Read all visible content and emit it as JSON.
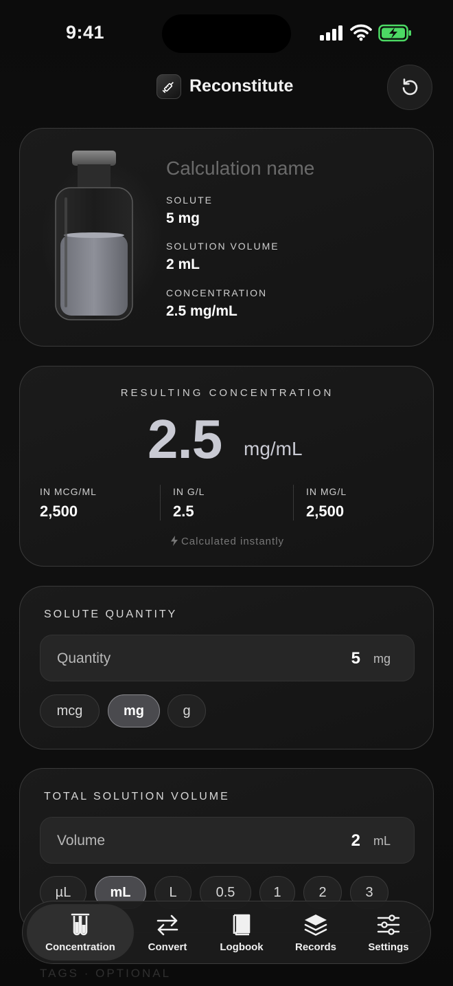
{
  "status": {
    "time": "9:41"
  },
  "header": {
    "title": "Reconstitute"
  },
  "summary": {
    "calc_name_placeholder": "Calculation name",
    "solute_label": "SOLUTE",
    "solute_value": "5 mg",
    "volume_label": "SOLUTION VOLUME",
    "volume_value": "2 mL",
    "concentration_label": "CONCENTRATION",
    "concentration_value": "2.5 mg/mL"
  },
  "result": {
    "label": "RESULTING CONCENTRATION",
    "value": "2.5",
    "unit": "mg/mL",
    "stats": [
      {
        "label": "IN MCG/ML",
        "value": "2,500"
      },
      {
        "label": "IN G/L",
        "value": "2.5"
      },
      {
        "label": "IN MG/L",
        "value": "2,500"
      }
    ],
    "instant": "Calculated instantly"
  },
  "solute": {
    "title": "SOLUTE QUANTITY",
    "field_label": "Quantity",
    "field_value": "5",
    "field_unit": "mg",
    "units": [
      "mcg",
      "mg",
      "g"
    ],
    "selected_unit": "mg"
  },
  "volume": {
    "title": "TOTAL SOLUTION VOLUME",
    "field_label": "Volume",
    "field_value": "2",
    "field_unit": "mL",
    "chips": [
      "µL",
      "mL",
      "L",
      "0.5",
      "1",
      "2",
      "3"
    ],
    "selected_chip": "mL"
  },
  "tags": {
    "title": "TAGS · OPTIONAL"
  },
  "tabs": [
    {
      "label": "Concentration",
      "icon": "test-tubes-icon",
      "active": true
    },
    {
      "label": "Convert",
      "icon": "arrows-exchange-icon",
      "active": false
    },
    {
      "label": "Logbook",
      "icon": "book-icon",
      "active": false
    },
    {
      "label": "Records",
      "icon": "layers-icon",
      "active": false
    },
    {
      "label": "Settings",
      "icon": "sliders-icon",
      "active": false
    }
  ],
  "colors": {
    "accent": "#c9cad3",
    "battery": "#4cd964"
  }
}
